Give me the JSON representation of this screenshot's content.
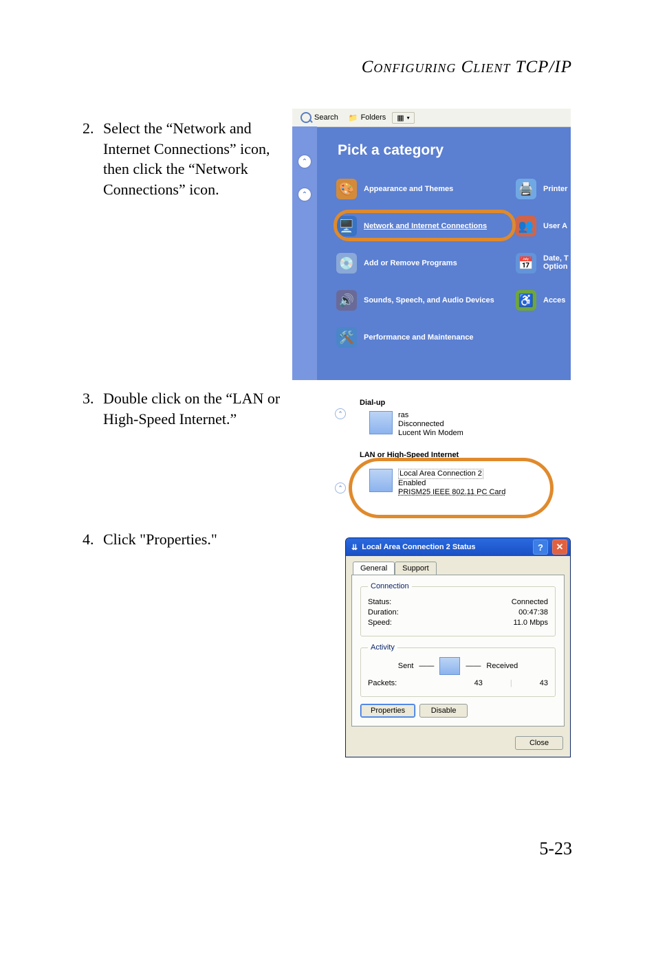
{
  "header": "Configuring Client TCP/IP",
  "page_number": "5-23",
  "steps": {
    "2": {
      "num": "2.",
      "text": "Select the “Network and Internet Connections” icon, then click the “Network Connections” icon."
    },
    "3": {
      "num": "3.",
      "text": "Double click on the “LAN or High-Speed Internet.”"
    },
    "4": {
      "num": "4.",
      "text": "Click \"Properties.\""
    }
  },
  "shot1": {
    "toolbar": {
      "search": "Search",
      "folders": "Folders"
    },
    "title": "Pick a category",
    "cats_left": [
      "Appearance and Themes",
      "Network and Internet Connections",
      "Add or Remove Programs",
      "Sounds, Speech, and Audio Devices",
      "Performance and Maintenance"
    ],
    "cats_right": [
      "Printer",
      "User A",
      "Date, T\nOption",
      "Acces"
    ]
  },
  "shot2": {
    "group1": "Dial-up",
    "item1": {
      "name": "ras",
      "status": "Disconnected",
      "device": "Lucent Win Modem"
    },
    "group2": "LAN or High-Speed Internet",
    "item2": {
      "name": "Local Area Connection 2",
      "status": "Enabled",
      "device": "PRISM25 IEEE 802.11 PC Card"
    }
  },
  "shot3": {
    "title": "Local Area Connection 2 Status",
    "tabs": {
      "general": "General",
      "support": "Support"
    },
    "connection": {
      "legend": "Connection",
      "status_label": "Status:",
      "status": "Connected",
      "duration_label": "Duration:",
      "duration": "00:47:38",
      "speed_label": "Speed:",
      "speed": "11.0 Mbps"
    },
    "activity": {
      "legend": "Activity",
      "sent": "Sent",
      "received": "Received",
      "packets_label": "Packets:",
      "sent_val": "43",
      "recv_val": "43"
    },
    "buttons": {
      "properties": "Properties",
      "disable": "Disable",
      "close": "Close"
    }
  }
}
